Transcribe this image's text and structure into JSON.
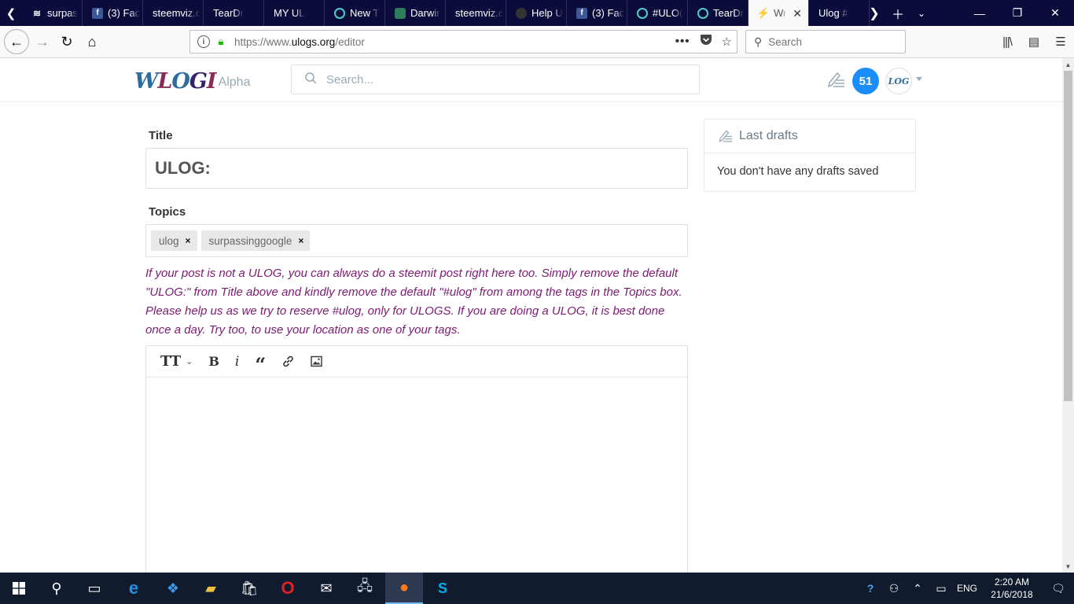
{
  "browser": {
    "tabs": [
      {
        "label": "surpas",
        "icon": "steemit-icon",
        "favclass": "steem"
      },
      {
        "label": "(3) Fac",
        "icon": "facebook-icon",
        "favclass": "fb"
      },
      {
        "label": "steemviz.c",
        "icon": "",
        "favclass": "none"
      },
      {
        "label": "TearDr",
        "icon": "",
        "favclass": "none"
      },
      {
        "label": "MY UL",
        "icon": "",
        "favclass": "none"
      },
      {
        "label": "New T",
        "icon": "teardrop-icon",
        "favclass": "teardrop"
      },
      {
        "label": "Darwir",
        "icon": "darwin-icon",
        "favclass": "darwin"
      },
      {
        "label": "steemviz.c",
        "icon": "",
        "favclass": "none"
      },
      {
        "label": "Help U",
        "icon": "github-icon",
        "favclass": "github"
      },
      {
        "label": "(3) Fac",
        "icon": "facebook-icon",
        "favclass": "fb"
      },
      {
        "label": "#ULO(",
        "icon": "teardrop-icon",
        "favclass": "teardrop"
      },
      {
        "label": "TearDr",
        "icon": "teardrop-icon",
        "favclass": "teardrop"
      },
      {
        "label": "Wr",
        "icon": "bolt-icon",
        "favclass": "none",
        "active": true
      },
      {
        "label": "Ulog #",
        "icon": "",
        "favclass": "none"
      }
    ],
    "url_prefix": "https://www.",
    "url_domain": "ulogs.org",
    "url_path": "/editor",
    "search_placeholder": "Search"
  },
  "site": {
    "logo_text": "ULOGS",
    "logo_alpha": "Alpha",
    "search_placeholder": "Search...",
    "notification_count": "51",
    "avatar_text": "LOG"
  },
  "editor": {
    "title_label": "Title",
    "title_value": "ULOG:",
    "topics_label": "Topics",
    "topics": [
      "ulog",
      "surpassinggoogle"
    ],
    "topic_remove": "×",
    "topics_hint": "If your post is not a ULOG, you can always do a steemit post right here too. Simply remove the default \"ULOG:\" from Title above and kindly remove the default \"#ulog\" from among the tags in the Topics box. Please help us as we try to reserve #ulog, only for ULOGS. If you are doing a ULOG, it is best done once a day. Try too, to use your location as one of your tags.",
    "toolbar": {
      "heading": "TT",
      "heading_caret": "⌄",
      "bold": "B",
      "italic": "i",
      "quote": "“"
    }
  },
  "drafts": {
    "title": "Last drafts",
    "empty_text": "You don't have any drafts saved"
  },
  "taskbar": {
    "language": "ENG",
    "time": "2:20 AM",
    "date": "21/6/2018"
  }
}
